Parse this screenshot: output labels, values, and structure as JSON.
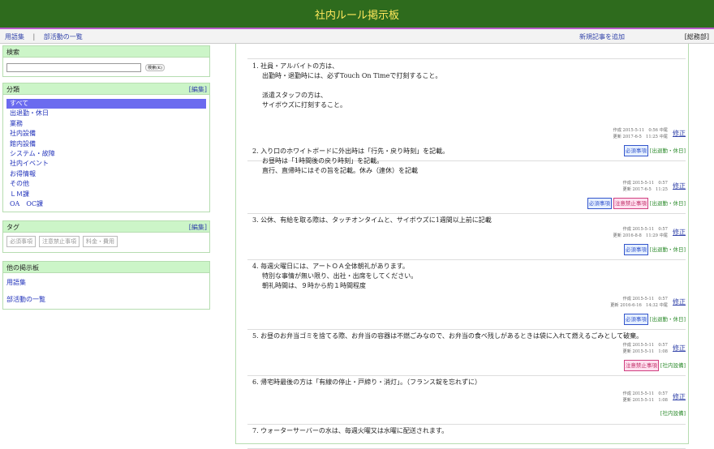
{
  "header": {
    "title": "社内ルール掲示板"
  },
  "nav": {
    "glossary": "用語集",
    "sep": "|",
    "clubs": "部活動の一覧",
    "new_post": "新規記事を追加",
    "admin": "[総務部]"
  },
  "search": {
    "title": "検索",
    "button": "検索(K)",
    "placeholder": ""
  },
  "categories": {
    "title": "分類",
    "edit": "[編集]",
    "items": [
      "すべて",
      "出退勤・休日",
      "業務",
      "社内設備",
      "館内設備",
      "システム・故障",
      "社内イベント",
      "お得情報",
      "その他",
      "ＬＭ課",
      "OA　OC課"
    ]
  },
  "tags": {
    "title": "タグ",
    "edit": "[編集]",
    "items": [
      "必須事項",
      "注意禁止事項",
      "料金・費用"
    ]
  },
  "other": {
    "title": "他の掲示板",
    "items": [
      "用語集",
      "部活動の一覧"
    ]
  },
  "posts": [
    {
      "lines": [
        "1. 社員・アルバイトの方は、",
        "出勤時・退勤時には、必ずTouch On Timeで打刻すること。",
        "",
        "派遣スタッフの方は、",
        "サイボウズに打刻すること。"
      ],
      "created": "作成 2015-5-11　0:56 中尾",
      "updated": "更新 2017-6-5　11:25 中尾",
      "fix": "修正",
      "tags": [
        "必須事項"
      ],
      "cat": "[出退勤・休日]"
    },
    {
      "lines": [
        "2. 入り口のホワイトボードに外出時は「行先・戻り時刻」を記載。",
        "お昼時は「1時間後の戻り時刻」を記載。",
        "直行、直帰時にはその旨を記載。休み（連休）を記載"
      ],
      "created": "作成 2015-5-11　0:57",
      "updated": "更新 2017-6-5　11:25",
      "fix": "修正",
      "tags": [
        "必須事項",
        "注意禁止事項"
      ],
      "cat": "[出退勤・休日]"
    },
    {
      "lines": [
        "3. 公休、有給を取る際は、タッチオンタイムと、サイボウズに1週間以上前に記載"
      ],
      "created": "作成 2015-5-11　0:57",
      "updated": "更新 2016-8-8　11:29 中尾",
      "fix": "修正",
      "tags": [
        "必須事項"
      ],
      "cat": "[出退勤・休日]"
    },
    {
      "lines": [
        "4. 毎週火曜日には、アートＯＡ全体朝礼があります。",
        "特別な事情が無い限り、出社・出席をしてください。",
        "朝礼時間は、９時から約１時間程度"
      ],
      "created": "作成 2015-5-11　0:57",
      "updated": "更新 2016-6-16　14:32 中尾",
      "fix": "修正",
      "tags": [
        "必須事項"
      ],
      "cat": "[出退勤・休日]"
    },
    {
      "lines": [
        "5. お昼のお弁当ゴミを捨てる際、お弁当の容器は不燃ごみなので、お弁当の食べ残しがあるときは袋に入れて燃えるごみとして破棄。"
      ],
      "created": "作成 2015-5-11　0:57",
      "updated": "更新 2015-5-11　1:08",
      "fix": "修正",
      "tags": [
        "注意禁止事項"
      ],
      "cat": "[社内設備]"
    },
    {
      "lines": [
        "6. 帰宅時最後の方は「有線の停止・戸締り・消灯」。（フランス錠を忘れずに）"
      ],
      "created": "作成 2015-5-11　0:57",
      "updated": "更新 2015-5-11　1:08",
      "fix": "修正",
      "tags": [],
      "cat": "[社内設備]"
    },
    {
      "lines": [
        "7. ウォーターサーバーの水は、毎週火曜又は水曜に配送されます。"
      ],
      "created": "",
      "updated": "",
      "fix": "",
      "tags": [],
      "cat": ""
    }
  ]
}
